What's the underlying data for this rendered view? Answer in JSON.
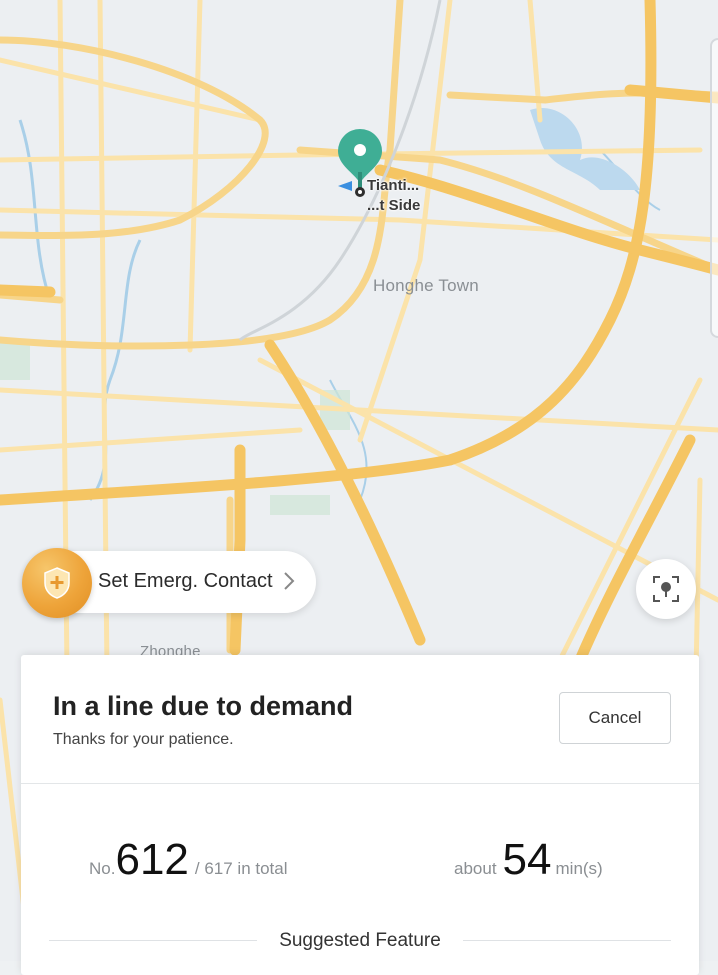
{
  "map": {
    "place_labels": {
      "honghe": "Honghe Town",
      "zhonghe": "Zhonghe"
    },
    "pin": {
      "label_line1": "Tianti...",
      "label_line2": "...t Side",
      "color": "#3fae95"
    },
    "road_color": "#f5c563",
    "water_color": "#a9cfe8"
  },
  "emergency": {
    "label": "Set Emerg. Contact",
    "icon": "shield-plus-icon",
    "badge_color": "#eea43a"
  },
  "locate": {
    "icon": "locate-pin-icon"
  },
  "queue_card": {
    "title": "In a line due to demand",
    "subtitle": "Thanks for your patience.",
    "cancel_label": "Cancel",
    "position_prefix": "No.",
    "position_value": "612",
    "position_total": "/ 617 in total",
    "wait_prefix": "about",
    "wait_value": "54",
    "wait_unit": "min(s)",
    "suggested_label": "Suggested Feature"
  }
}
